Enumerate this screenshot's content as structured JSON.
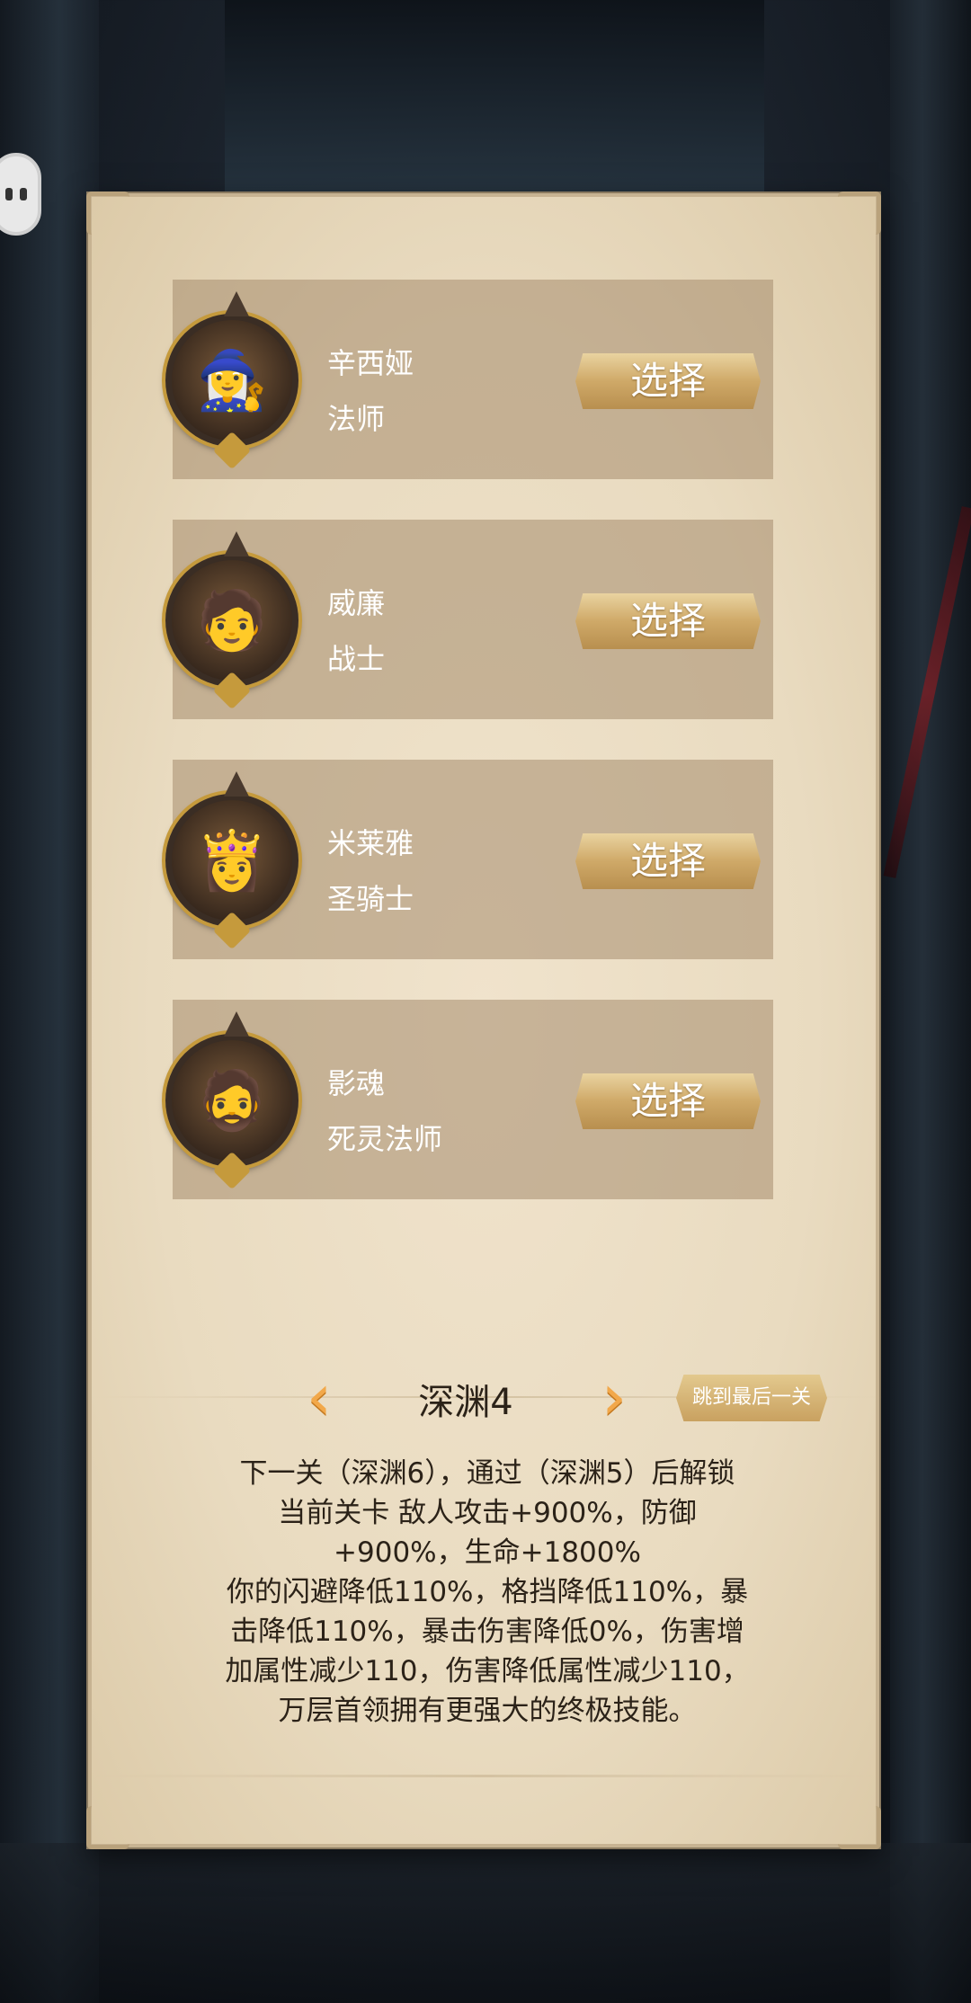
{
  "heroes": [
    {
      "name": "辛西娅",
      "class": "法师",
      "select_label": "选择",
      "avatar_icon": "witch-portrait-icon",
      "avatar_glyph": "🧙‍♀️"
    },
    {
      "name": "威廉",
      "class": "战士",
      "select_label": "选择",
      "avatar_icon": "warrior-portrait-icon",
      "avatar_glyph": "🧑"
    },
    {
      "name": "米莱雅",
      "class": "圣骑士",
      "select_label": "选择",
      "avatar_icon": "paladin-portrait-icon",
      "avatar_glyph": "👸"
    },
    {
      "name": "影魂",
      "class": "死灵法师",
      "select_label": "选择",
      "avatar_icon": "necromancer-portrait-icon",
      "avatar_glyph": "🧔"
    }
  ],
  "stage": {
    "title": "深渊4",
    "prev_icon": "chevron-left-icon",
    "prev_glyph": "‹",
    "next_icon": "chevron-right-icon",
    "next_glyph": "›",
    "jump_label": "跳到最后一关"
  },
  "description": [
    "下一关（深渊6），通过（深渊5）后解锁",
    "当前关卡 敌人攻击+900%，防御",
    "+900%，生命+1800%",
    "你的闪避降低110%，格挡降低110%，暴",
    "击降低110%，暴击伤害降低0%，伤害增",
    "加属性减少110，伤害降低属性减少110，",
    "万层首领拥有更强大的终极技能。"
  ]
}
